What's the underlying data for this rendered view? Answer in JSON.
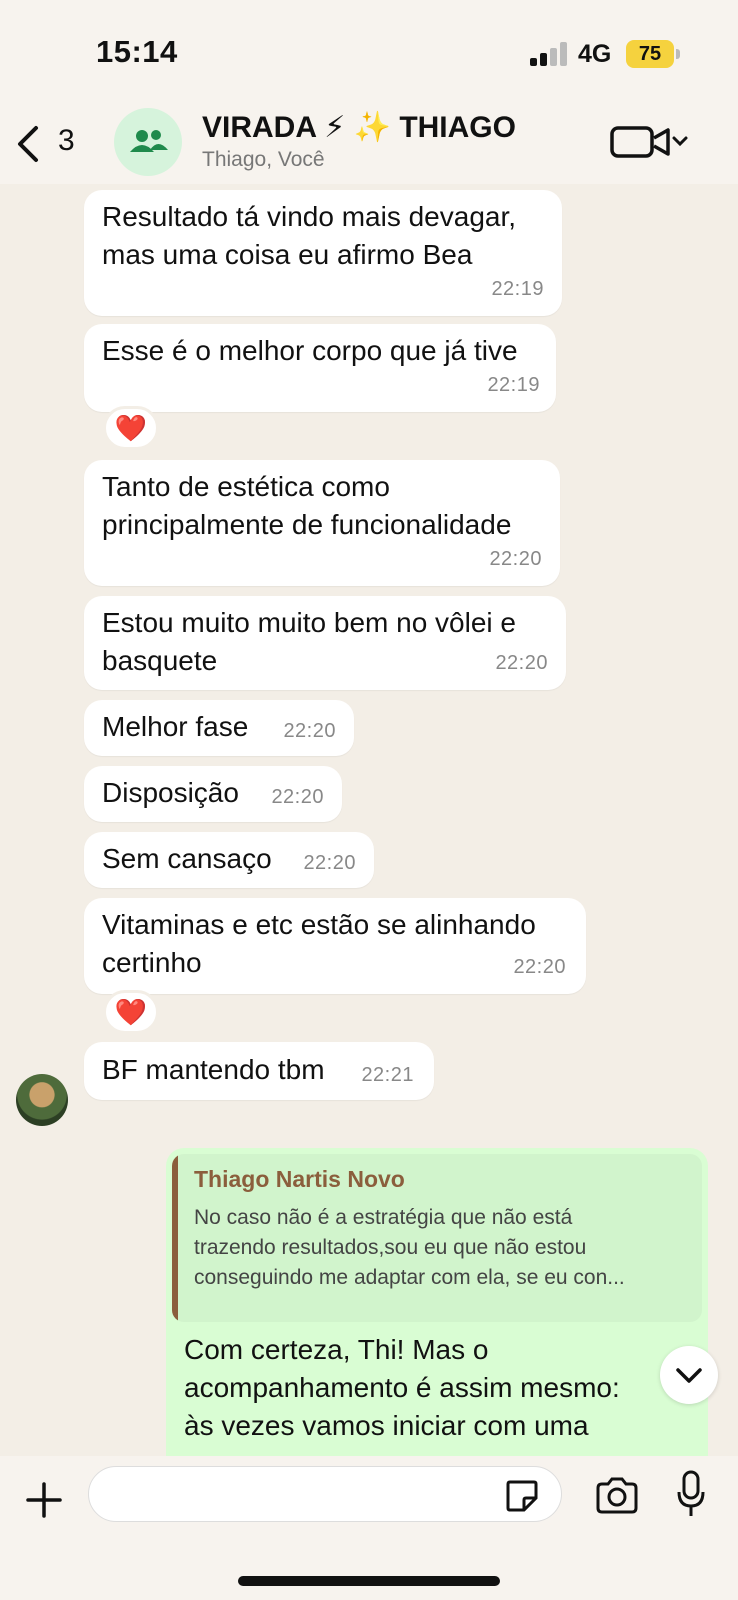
{
  "status": {
    "time": "15:14",
    "network": "4G",
    "battery": "75"
  },
  "header": {
    "back_count": "3",
    "title": "VIRADA ⚡ ✨ THIAGO",
    "subtitle": "Thiago, Você"
  },
  "messages": [
    {
      "lines": [
        "Resultado tá vindo mais devagar,",
        "mas uma coisa eu afirmo Bea"
      ],
      "time": "22:19"
    },
    {
      "lines": [
        "Esse é o melhor corpo que já tive"
      ],
      "time": "22:19",
      "reaction": "❤️"
    },
    {
      "lines": [
        "Tanto de estética como",
        "principalmente de funcionalidade"
      ],
      "time": "22:20"
    },
    {
      "lines": [
        "Estou muito muito bem no vôlei e",
        "basquete"
      ],
      "time": "22:20"
    },
    {
      "lines": [
        "Melhor fase"
      ],
      "time": "22:20"
    },
    {
      "lines": [
        "Disposição"
      ],
      "time": "22:20"
    },
    {
      "lines": [
        "Sem cansaço"
      ],
      "time": "22:20"
    },
    {
      "lines": [
        "Vitaminas e etc estão se alinhando",
        "certinho"
      ],
      "time": "22:20",
      "reaction": "❤️"
    },
    {
      "lines": [
        "BF mantendo tbm"
      ],
      "time": "22:21"
    }
  ],
  "reply": {
    "quoted_name": "Thiago Nartis Novo",
    "quoted_lines": [
      "No caso não é a estratégia que não está",
      "trazendo resultados,sou eu que não estou",
      "conseguindo me adaptar com ela, se eu con..."
    ],
    "text_lines": [
      "Com certeza, Thi! Mas o",
      "acompanhamento é assim mesmo:",
      "às vezes vamos iniciar com uma"
    ]
  },
  "input": {
    "placeholder": ""
  },
  "colors": {
    "incoming": "#ffffff",
    "outgoing": "#d9fdd3",
    "quote_accent": "#8b5e3c",
    "background": "#f3eee6"
  }
}
